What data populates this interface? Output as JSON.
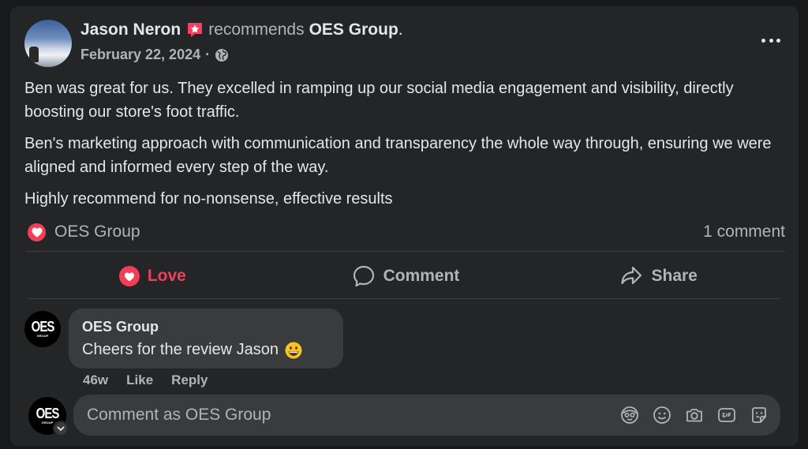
{
  "post": {
    "author": "Jason Neron",
    "recommends_word": "recommends",
    "page": "OES Group",
    "period": ".",
    "date": "February 22, 2024",
    "date_separator": "·",
    "paragraphs": [
      "Ben was great for us. They excelled in ramping up our social media engagement and visibility, directly boosting our store's foot traffic.",
      "Ben's marketing approach with communication and transparency the whole way through, ensuring we were aligned and informed every step of the way.",
      "Highly recommend for no-nonsense, effective results"
    ]
  },
  "stats": {
    "reactor": "OES Group",
    "comments": "1 comment"
  },
  "actions": {
    "love": "Love",
    "comment": "Comment",
    "share": "Share"
  },
  "comment": {
    "avatar_main": "OES",
    "avatar_sub": "GROUP",
    "author": "OES Group",
    "text": "Cheers for the review Jason",
    "age": "46w",
    "like": "Like",
    "reply": "Reply"
  },
  "composer": {
    "placeholder": "Comment as OES Group"
  },
  "colors": {
    "background": "#18191a",
    "card": "#242526",
    "bubble": "#3a3b3c",
    "love": "#f33e58",
    "badge": "#f3425f",
    "text_primary": "#e4e6eb",
    "text_secondary": "#b0b3b8"
  },
  "icons": [
    "recommendation-badge-icon",
    "globe-icon",
    "more-icon",
    "love-reaction-icon",
    "comment-icon",
    "share-icon",
    "grinning-emoji-icon",
    "avatar-sticker-icon",
    "emoji-icon",
    "camera-icon",
    "gif-icon",
    "sticker-icon",
    "chevron-down-icon"
  ]
}
